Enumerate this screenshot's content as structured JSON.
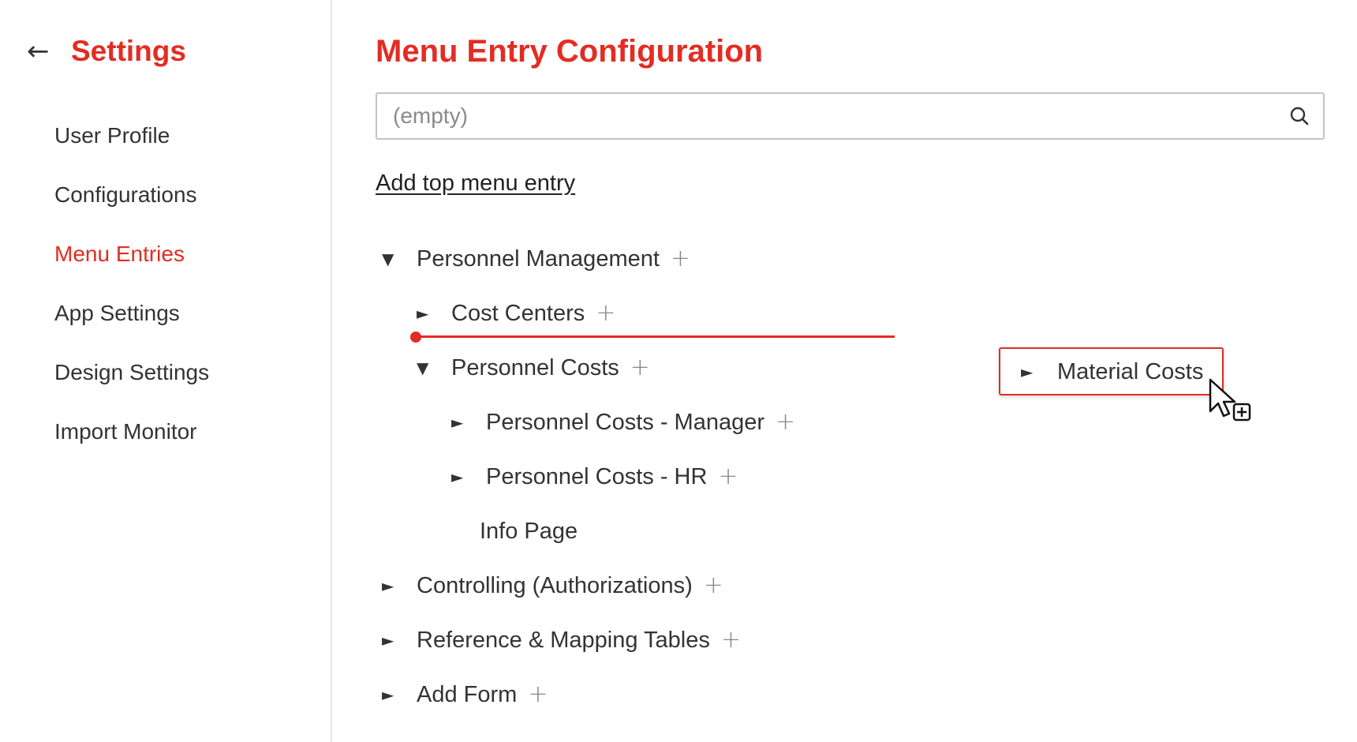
{
  "sidebar": {
    "back_arrow": "←",
    "title": "Settings",
    "items": [
      {
        "label": "User Profile",
        "active": false
      },
      {
        "label": "Configurations",
        "active": false
      },
      {
        "label": "Menu Entries",
        "active": true
      },
      {
        "label": "App Settings",
        "active": false
      },
      {
        "label": "Design Settings",
        "active": false
      },
      {
        "label": "Import Monitor",
        "active": false
      }
    ]
  },
  "main": {
    "title": "Menu Entry Configuration",
    "search": {
      "placeholder": "(empty)",
      "value": "",
      "icon": "search-icon"
    },
    "add_top_label": "Add top menu entry",
    "tree": [
      {
        "label": "Personnel Management",
        "caret": "▼",
        "plus": "+"
      },
      {
        "label": "Cost Centers",
        "caret": "►",
        "plus": "+"
      },
      {
        "label": "Personnel Costs",
        "caret": "▼",
        "plus": "+"
      },
      {
        "label": "Personnel Costs - Manager",
        "caret": "►",
        "plus": "+"
      },
      {
        "label": "Personnel Costs - HR",
        "caret": "►",
        "plus": "+"
      },
      {
        "label": "Info Page"
      },
      {
        "label": "Controlling (Authorizations)",
        "caret": "►",
        "plus": "+"
      },
      {
        "label": "Reference & Mapping Tables",
        "caret": "►",
        "plus": "+"
      },
      {
        "label": "Add Form",
        "caret": "►",
        "plus": "+"
      }
    ],
    "drag_ghost": {
      "label": "Material Costs",
      "caret": "►"
    }
  },
  "colors": {
    "accent": "#e32c23",
    "text": "#333333",
    "muted": "#888888",
    "border": "#c4c4c4"
  }
}
